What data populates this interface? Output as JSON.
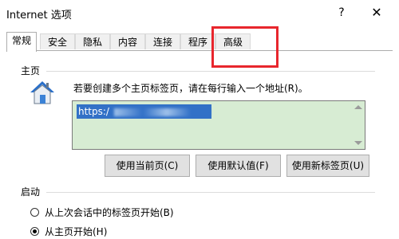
{
  "window": {
    "title": "Internet 选项",
    "help_glyph": "?",
    "close_glyph": "✕"
  },
  "tabs": [
    {
      "label": "常规",
      "active": true
    },
    {
      "label": "安全",
      "active": false
    },
    {
      "label": "隐私",
      "active": false
    },
    {
      "label": "内容",
      "active": false
    },
    {
      "label": "连接",
      "active": false
    },
    {
      "label": "程序",
      "active": false
    },
    {
      "label": "高级",
      "active": false
    }
  ],
  "annotation": {
    "color": "#e8262d",
    "target": "高级"
  },
  "home_page": {
    "group_label": "主页",
    "description": "若要创建多个主页标签页，请在每行输入一个地址(R)。",
    "url_value": "https:/",
    "textarea_bg": "#d7ecd3",
    "buttons": {
      "use_current": "使用当前页(C)",
      "use_default": "使用默认值(F)",
      "use_new_tab": "使用新标签页(U)"
    }
  },
  "startup": {
    "group_label": "启动",
    "options": [
      {
        "label": "从上次会话中的标签页开始(B)",
        "checked": false
      },
      {
        "label": "从主页开始(H)",
        "checked": true
      }
    ]
  }
}
